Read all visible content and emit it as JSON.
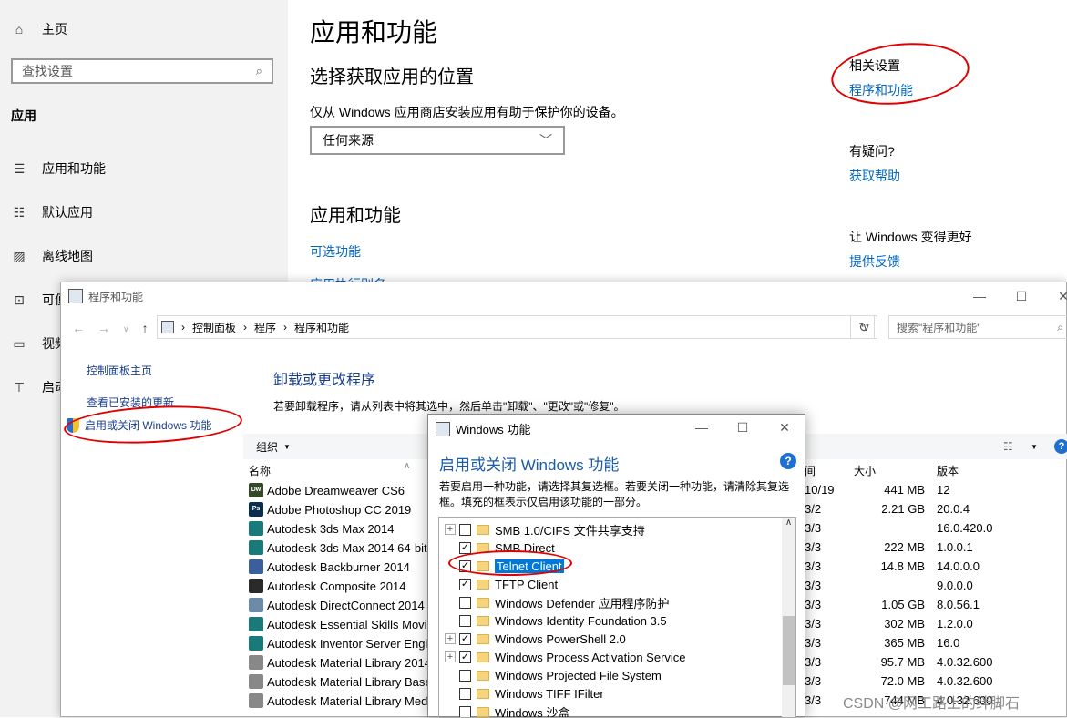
{
  "settings": {
    "sidebar": {
      "home": "主页",
      "search_placeholder": "查找设置",
      "section": "应用",
      "items": [
        "应用和功能",
        "默认应用",
        "离线地图",
        "可便",
        "视频",
        "启动"
      ]
    },
    "title": "应用和功能",
    "source_heading": "选择获取应用的位置",
    "source_desc": "仅从 Windows 应用商店安装应用有助于保护你的设备。",
    "source_value": "任何来源",
    "apps_heading": "应用和功能",
    "optional_link": "可选功能",
    "partial_link": "应用执行别名",
    "related_title": "相关设置",
    "related_link": "程序和功能",
    "question_title": "有疑问?",
    "help_link": "获取帮助",
    "improve_title": "让 Windows 变得更好",
    "feedback_link": "提供反馈"
  },
  "control_panel": {
    "title": "程序和功能",
    "breadcrumb": [
      "控制面板",
      "程序",
      "程序和功能"
    ],
    "search_placeholder": "搜索\"程序和功能\"",
    "left_links": [
      "控制面板主页",
      "查看已安装的更新",
      "启用或关闭 Windows 功能"
    ],
    "heading": "卸载或更改程序",
    "desc": "若要卸载程序，请从列表中将其选中，然后单击\"卸载\"、\"更改\"或\"修复\"。",
    "organize": "组织",
    "columns": {
      "name": "名称",
      "time": "间",
      "size": "大小",
      "version": "版本"
    },
    "rows": [
      {
        "name": "Adobe Dreamweaver CS6",
        "date": "10/19",
        "size": "441 MB",
        "version": "12",
        "icon": "Dw",
        "color": "#35482a"
      },
      {
        "name": "Adobe Photoshop CC 2019",
        "date": "3/2",
        "size": "2.21 GB",
        "version": "20.0.4",
        "icon": "Ps",
        "color": "#0c2e4e"
      },
      {
        "name": "Autodesk 3ds Max 2014",
        "date": "3/3",
        "size": "",
        "version": "16.0.420.0",
        "icon": "",
        "color": "#1a7a7a"
      },
      {
        "name": "Autodesk 3ds Max 2014 64-bit",
        "date": "3/3",
        "size": "222 MB",
        "version": "1.0.0.1",
        "icon": "",
        "color": "#1a7a7a"
      },
      {
        "name": "Autodesk Backburner 2014",
        "date": "3/3",
        "size": "14.8 MB",
        "version": "14.0.0.0",
        "icon": "",
        "color": "#3a5f9a"
      },
      {
        "name": "Autodesk Composite 2014",
        "date": "3/3",
        "size": "",
        "version": "9.0.0.0",
        "icon": "",
        "color": "#2a2a2a"
      },
      {
        "name": "Autodesk DirectConnect 2014",
        "date": "3/3",
        "size": "1.05 GB",
        "version": "8.0.56.1",
        "icon": "",
        "color": "#6a8aa8"
      },
      {
        "name": "Autodesk Essential Skills Movies",
        "date": "3/3",
        "size": "302 MB",
        "version": "1.2.0.0",
        "icon": "",
        "color": "#1a7a7a"
      },
      {
        "name": "Autodesk Inventor Server Engine",
        "date": "3/3",
        "size": "365 MB",
        "version": "16.0",
        "icon": "",
        "color": "#1a7a7a"
      },
      {
        "name": "Autodesk Material Library 2014",
        "date": "3/3",
        "size": "95.7 MB",
        "version": "4.0.32.600",
        "icon": "",
        "color": "#888888"
      },
      {
        "name": "Autodesk Material Library Base",
        "date": "3/3",
        "size": "72.0 MB",
        "version": "4.0.32.600",
        "icon": "",
        "color": "#888888"
      },
      {
        "name": "Autodesk Material Library Med",
        "date": "3/3",
        "size": "744 MB",
        "version": "4.0.32.600",
        "icon": "",
        "color": "#888888"
      }
    ]
  },
  "features_dialog": {
    "title": "Windows 功能",
    "heading": "启用或关闭 Windows 功能",
    "desc": "若要启用一种功能，请选择其复选框。若要关闭一种功能，请清除其复选框。填充的框表示仅启用该功能的一部分。",
    "features": [
      {
        "label": "SMB 1.0/CIFS 文件共享支持",
        "expand": "+",
        "checked": false
      },
      {
        "label": "SMB Direct",
        "expand": "",
        "checked": true
      },
      {
        "label": "Telnet Client",
        "expand": "",
        "checked": true,
        "selected": true
      },
      {
        "label": "TFTP Client",
        "expand": "",
        "checked": true
      },
      {
        "label": "Windows Defender 应用程序防护",
        "expand": "",
        "checked": false
      },
      {
        "label": "Windows Identity Foundation 3.5",
        "expand": "",
        "checked": false
      },
      {
        "label": "Windows PowerShell 2.0",
        "expand": "+",
        "checked": true
      },
      {
        "label": "Windows Process Activation Service",
        "expand": "+",
        "checked": true
      },
      {
        "label": "Windows Projected File System",
        "expand": "",
        "checked": false
      },
      {
        "label": "Windows TIFF IFilter",
        "expand": "",
        "checked": false
      },
      {
        "label": "Windows 沙盒",
        "expand": "",
        "checked": false
      }
    ]
  },
  "watermark": "CSDN @网工路上的绊脚石"
}
